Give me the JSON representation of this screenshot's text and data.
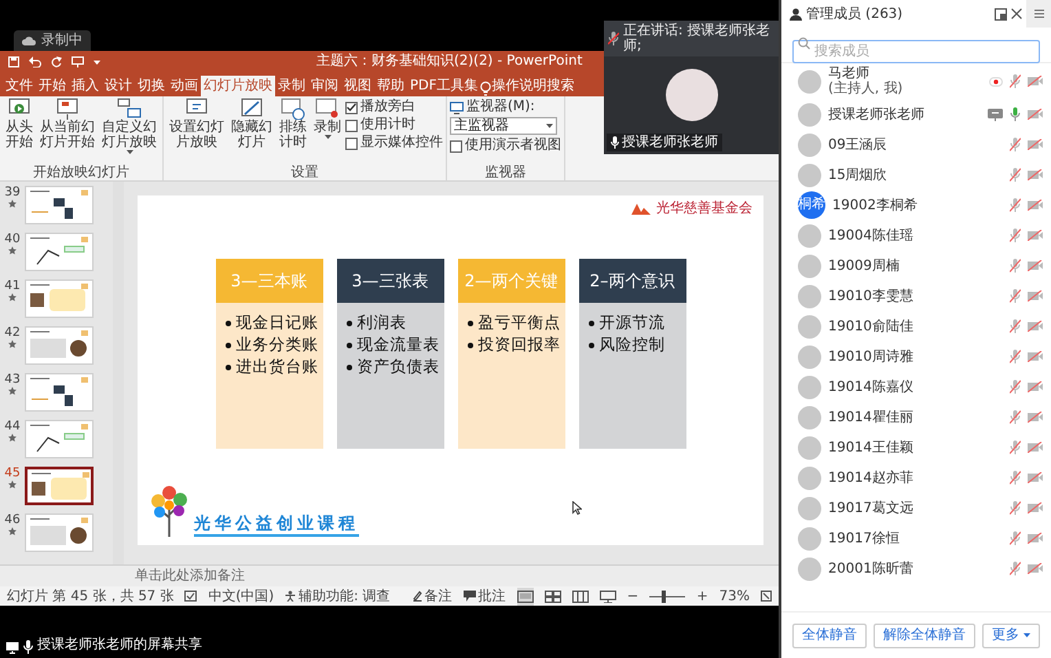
{
  "recording_badge": {
    "label": "录制中"
  },
  "powerpoint": {
    "title": "主题六：财务基础知识(2)(2)  -  PowerPoint",
    "tabs": [
      {
        "label": "文件",
        "selected": false
      },
      {
        "label": "开始",
        "selected": false
      },
      {
        "label": "插入",
        "selected": false
      },
      {
        "label": "设计",
        "selected": false
      },
      {
        "label": "切换",
        "selected": false
      },
      {
        "label": "动画",
        "selected": false
      },
      {
        "label": "幻灯片放映",
        "selected": true
      },
      {
        "label": "录制",
        "selected": false
      },
      {
        "label": "审阅",
        "selected": false
      },
      {
        "label": "视图",
        "selected": false
      },
      {
        "label": "帮助",
        "selected": false
      },
      {
        "label": "PDF工具集",
        "selected": false
      }
    ],
    "tell_me": "操作说明搜索",
    "ribbon_groups": [
      {
        "label": "开始放映幻灯片",
        "items": [
          {
            "kind": "button",
            "label": "从头开始"
          },
          {
            "kind": "button",
            "label": "从当前幻灯片开始"
          },
          {
            "kind": "dropdown_button",
            "label": "自定义幻灯片放映"
          }
        ]
      },
      {
        "label": "设置",
        "items": [
          {
            "kind": "button",
            "label": "设置幻灯片放映"
          },
          {
            "kind": "button",
            "label": "隐藏幻灯片"
          },
          {
            "kind": "button",
            "label": "排练计时"
          },
          {
            "kind": "dropdown_button",
            "label": "录制"
          },
          {
            "kind": "checkboxes",
            "options": [
              {
                "label": "播放旁白",
                "checked": true
              },
              {
                "label": "使用计时",
                "checked": false
              },
              {
                "label": "显示媒体控件",
                "checked": false
              }
            ]
          }
        ]
      },
      {
        "label": "监视器",
        "items": [
          {
            "kind": "select",
            "label": "监视器(M):",
            "value": "主监视器"
          },
          {
            "kind": "checkboxes",
            "options": [
              {
                "label": "使用演示者视图",
                "checked": false
              }
            ]
          }
        ]
      }
    ],
    "thumbnails": [
      {
        "number": "39",
        "selected": false
      },
      {
        "number": "40",
        "selected": false
      },
      {
        "number": "41",
        "selected": false
      },
      {
        "number": "42",
        "selected": false
      },
      {
        "number": "43",
        "selected": false
      },
      {
        "number": "44",
        "selected": false
      },
      {
        "number": "45",
        "selected": true
      },
      {
        "number": "46",
        "selected": false
      }
    ],
    "slide": {
      "org_name": "光华慈善基金会",
      "columns": [
        {
          "title": "3—三本账",
          "kind": "warm",
          "items": [
            "现金日记账",
            "业务分类账",
            "进出货台账"
          ]
        },
        {
          "title": "3—三张表",
          "kind": "cool",
          "items": [
            "利润表",
            "现金流量表",
            "资产负债表"
          ]
        },
        {
          "title": "2—两个关键",
          "kind": "warm",
          "items": [
            "盈亏平衡点",
            "投资回报率"
          ]
        },
        {
          "title": "2–两个意识",
          "kind": "cool",
          "items": [
            "开源节流",
            "风险控制"
          ]
        }
      ],
      "course_title": "光华公益创业课程"
    },
    "notes_placeholder": "单击此处添加备注",
    "status_bar": {
      "slide_info": "幻灯片 第 45 张，共 57 张",
      "language": "中文(中国)",
      "accessibility": "辅助功能: 调查",
      "notes": "备注",
      "comments": "批注",
      "views": [
        {
          "kind": "normal",
          "selected": true
        },
        {
          "kind": "sorter",
          "selected": false
        },
        {
          "kind": "reading",
          "selected": false
        },
        {
          "kind": "slideshow",
          "selected": false
        }
      ],
      "zoom_out": "−",
      "zoom": {
        "level": 0.36
      },
      "zoom_in": "+",
      "zoom_reading": "73%"
    }
  },
  "video_tile": {
    "speaking": "正在讲话: 授课老师张老师;",
    "name": "授课老师张老师"
  },
  "share_label": "授课老师张老师的屏幕共享",
  "members_panel": {
    "title": "管理成员 (263)",
    "search_placeholder": "搜索成员",
    "members": [
      {
        "name": "马老师",
        "role": "(主持人, 我)",
        "recording": true,
        "sharing": false,
        "mic_on": false,
        "camera_on": false
      },
      {
        "name": "授课老师张老师",
        "recording": false,
        "sharing": true,
        "mic_on": true,
        "camera_on": false
      },
      {
        "name": "09王涵辰",
        "recording": false,
        "sharing": false,
        "mic_on": false,
        "camera_on": false
      },
      {
        "name": "15周烟欣",
        "recording": false,
        "sharing": false,
        "mic_on": false,
        "camera_on": false
      },
      {
        "name": "19002李桐希",
        "avatar_text": "桐希",
        "recording": false,
        "sharing": false,
        "mic_on": false,
        "camera_on": false
      },
      {
        "name": "19004陈佳瑶",
        "recording": false,
        "sharing": false,
        "mic_on": false,
        "camera_on": false
      },
      {
        "name": "19009周楠",
        "recording": false,
        "sharing": false,
        "mic_on": false,
        "camera_on": false
      },
      {
        "name": "19010李雯慧",
        "recording": false,
        "sharing": false,
        "mic_on": false,
        "camera_on": false
      },
      {
        "name": "19010俞陆佳",
        "recording": false,
        "sharing": false,
        "mic_on": false,
        "camera_on": false
      },
      {
        "name": "19010周诗雅",
        "recording": false,
        "sharing": false,
        "mic_on": false,
        "camera_on": false
      },
      {
        "name": "19014陈嘉仪",
        "recording": false,
        "sharing": false,
        "mic_on": false,
        "camera_on": false
      },
      {
        "name": "19014瞿佳丽",
        "recording": false,
        "sharing": false,
        "mic_on": false,
        "camera_on": false
      },
      {
        "name": "19014王佳颖",
        "recording": false,
        "sharing": false,
        "mic_on": false,
        "camera_on": false
      },
      {
        "name": "19014赵亦菲",
        "recording": false,
        "sharing": false,
        "mic_on": false,
        "camera_on": false
      },
      {
        "name": "19017葛文远",
        "recording": false,
        "sharing": false,
        "mic_on": false,
        "camera_on": false
      },
      {
        "name": "19017徐恒",
        "recording": false,
        "sharing": false,
        "mic_on": false,
        "camera_on": false
      },
      {
        "name": "20001陈昕蕾",
        "recording": false,
        "sharing": false,
        "mic_on": false,
        "camera_on": false
      }
    ],
    "buttons": [
      "全体静音",
      "解除全体静音"
    ],
    "more": "更多"
  }
}
